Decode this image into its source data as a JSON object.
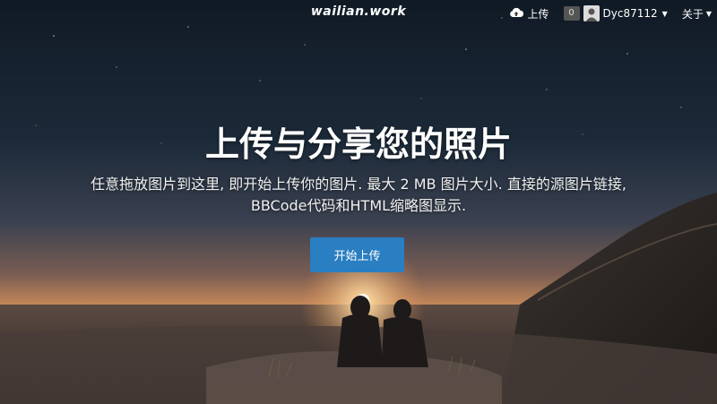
{
  "header": {
    "brand": "wailian.work",
    "upload_label": "上传",
    "notification_count": "0",
    "username": "Dyc87112",
    "about_label": "关于"
  },
  "hero": {
    "title": "上传与分享您的照片",
    "description": "任意拖放图片到这里, 即开始上传你的图片. 最大 2 MB 图片大小. 直接的源图片链接, BBCode代码和HTML缩略图显示.",
    "cta_label": "开始上传"
  },
  "icons": {
    "upload": "cloud-upload-icon",
    "avatar": "user-avatar-icon",
    "caret": "caret-down-icon"
  },
  "colors": {
    "accent": "#2a7ec2",
    "badge_bg": "#555555"
  }
}
